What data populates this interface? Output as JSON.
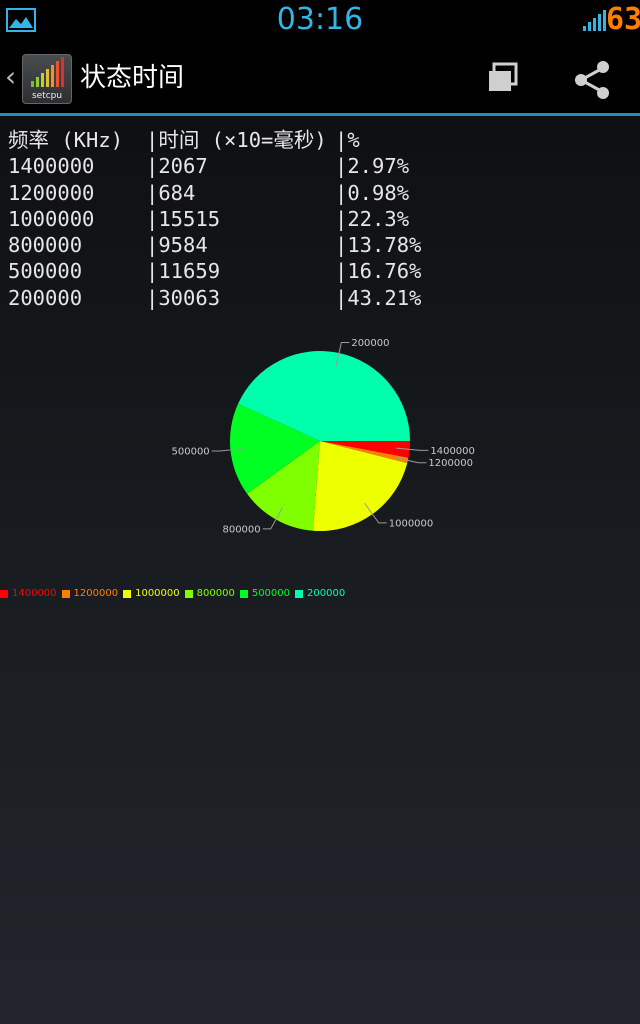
{
  "status_bar": {
    "time": "03:16",
    "battery": "63",
    "notification_icon": "image-icon",
    "signal_icon": "signal-icon",
    "time_color": "#33b5e5",
    "battery_color": "#ff7f00"
  },
  "action_bar": {
    "app_icon_label": "setcpu",
    "title": "状态时间",
    "back_icon": "chevron-left-icon",
    "window_icon": "overlapping-windows-icon",
    "share_icon": "share-icon",
    "accent_color": "#2a8ab8"
  },
  "stats_table": {
    "headers": [
      "频率 (KHz)",
      "|时间 (×10=毫秒)",
      "|%"
    ],
    "rows": [
      [
        "1400000",
        "|2067",
        "|2.97%"
      ],
      [
        "1200000",
        "|684",
        "|0.98%"
      ],
      [
        "1000000",
        "|15515",
        "|22.3%"
      ],
      [
        "800000",
        "|9584",
        "|13.78%"
      ],
      [
        "500000",
        "|11659",
        "|16.76%"
      ],
      [
        "200000",
        "|30063",
        "|43.21%"
      ]
    ]
  },
  "chart_data": {
    "type": "pie",
    "categories": [
      "1400000",
      "1200000",
      "1000000",
      "800000",
      "500000",
      "200000"
    ],
    "values": [
      2.97,
      0.98,
      22.3,
      13.78,
      16.76,
      43.21
    ],
    "colors": [
      "#ff0000",
      "#ff8000",
      "#eeff00",
      "#80ff00",
      "#00ff22",
      "#00ffaa"
    ],
    "legend_position": "bottom-left",
    "slice_labels": [
      "1400000",
      "1200000",
      "1000000",
      "800000",
      "500000",
      "200000"
    ]
  }
}
